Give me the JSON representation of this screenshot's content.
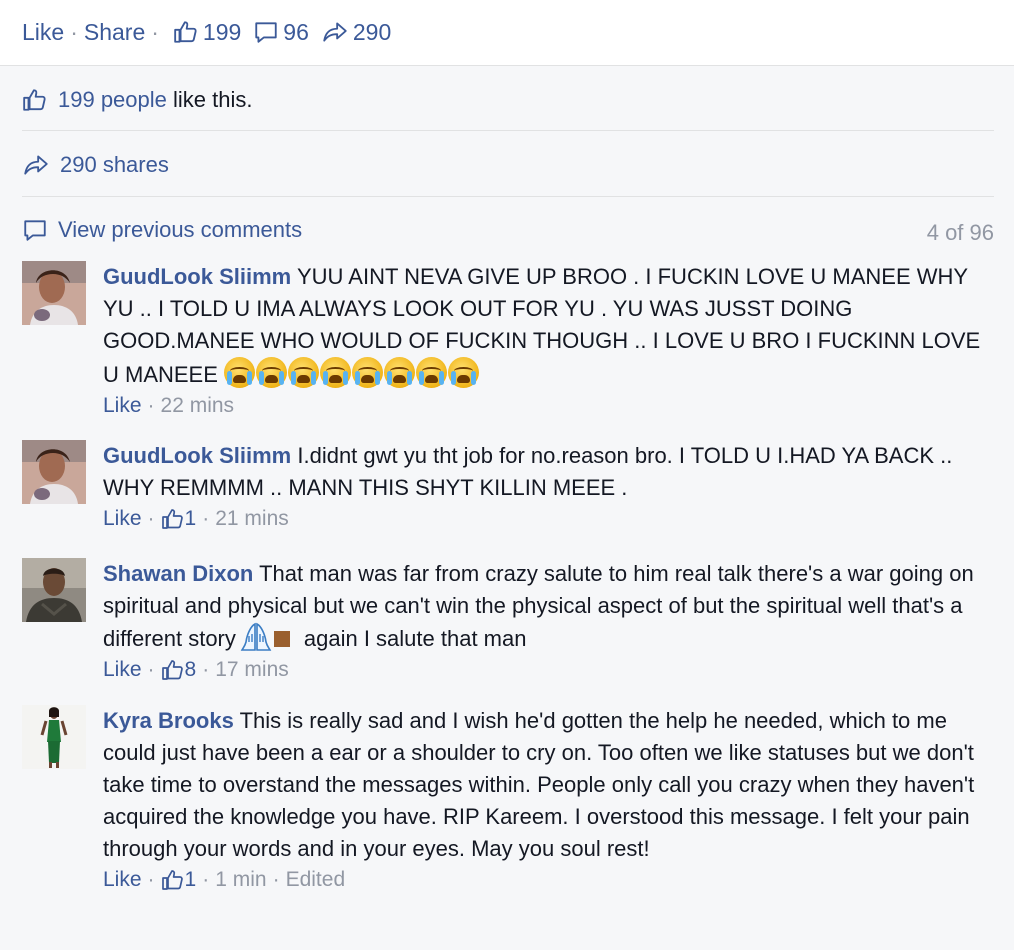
{
  "action_bar": {
    "like_label": "Like",
    "sep1": "·",
    "share_label": "Share",
    "sep2": "·",
    "likes_count": "199",
    "comments_count": "96",
    "shares_count": "290"
  },
  "summary": {
    "likes_count_link": "199 people",
    "likes_suffix": " like this.",
    "shares_link": "290 shares",
    "view_previous": "View previous comments",
    "comment_position": "4 of 96"
  },
  "comments": [
    {
      "author": "GuudLook Sliimm",
      "text": "YUU AINT NEVA GIVE UP BROO . I FUCKIN LOVE U MANEE WHY YU .. I TOLD U IMA ALWAYS LOOK OUT FOR YU . YU WAS JUSST DOING GOOD.MANEE WHO WOULD OF FUCKIN THOUGH .. I LOVE U BRO I FUCKINN LOVE U MANEEE",
      "emoji": "loudly-crying-face x8",
      "like_label": "Like",
      "time": "22 mins"
    },
    {
      "author": "GuudLook Sliimm",
      "text": "I.didnt gwt yu tht job for no.reason bro. I TOLD U I.HAD YA BACK .. WHY REMMMM .. MANN THIS SHYT KILLIN MEEE .",
      "like_label": "Like",
      "likes": "1",
      "time": "21 mins"
    },
    {
      "author": "Shawan Dixon",
      "text": "That man was far from crazy salute to him real talk there's a war going on spiritual and physical but we can't win the physical aspect of but the spiritual well that's a different story",
      "text_after": "again I salute that man",
      "like_label": "Like",
      "likes": "8",
      "time": "17 mins"
    },
    {
      "author": "Kyra Brooks",
      "text": "This is really sad and I wish he'd gotten the help he needed, which to me could just have been a ear or a shoulder to cry on. Too often we like statuses but we don't take time to overstand the messages within. People only call you crazy when they haven't acquired the knowledge you have. RIP Kareem. I overstood this message. I felt your pain through your words and in your eyes. May you soul rest!",
      "like_label": "Like",
      "likes": "1",
      "time": "1 min",
      "edited": "Edited"
    }
  ],
  "colors": {
    "link": "#3b5998",
    "meta_gray": "#9197a3",
    "ufi_background": "#f6f7f9"
  }
}
